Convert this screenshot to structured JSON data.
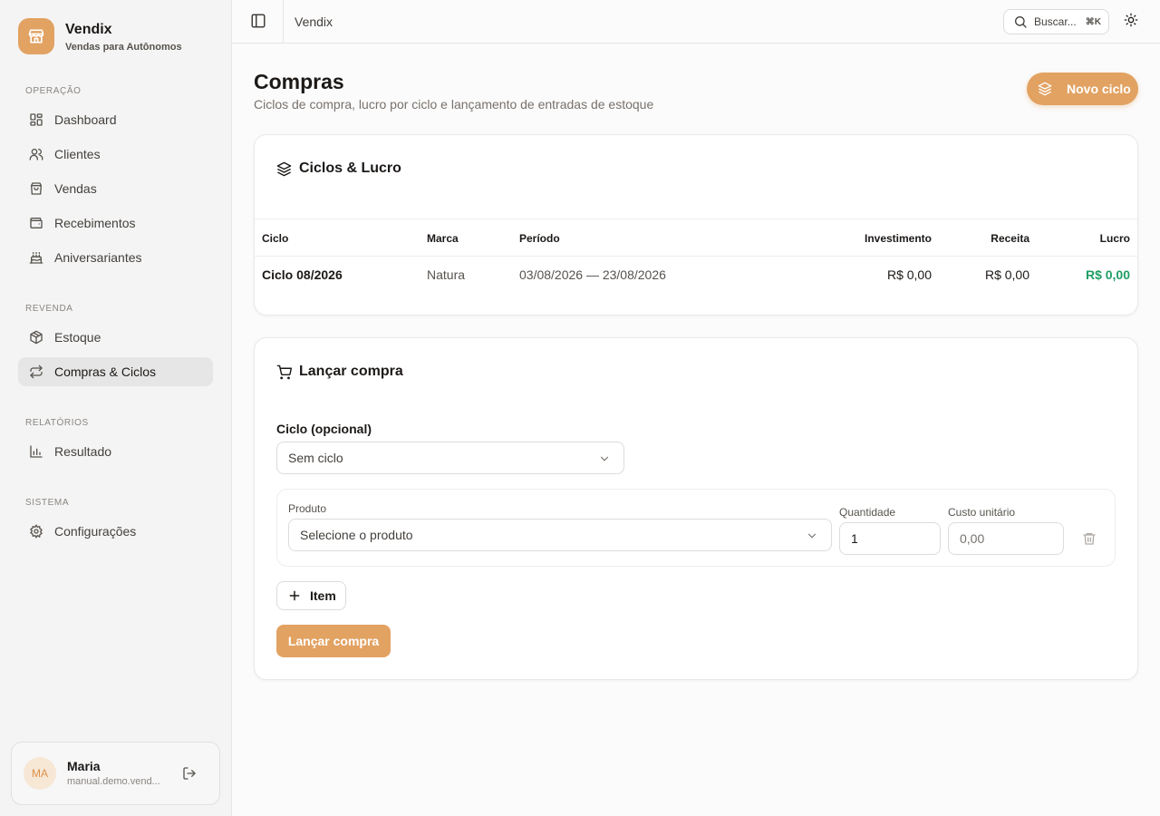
{
  "colors": {
    "accent": "#e2a262",
    "profit": "#1f9d64"
  },
  "brand": {
    "name": "Vendix",
    "subtitle": "Vendas para Autônomos",
    "logo_icon": "store-icon"
  },
  "sidebar": {
    "sections": [
      {
        "label": "Operação"
      },
      {
        "label": "Revenda"
      },
      {
        "label": "Relatórios"
      },
      {
        "label": "Sistema"
      }
    ],
    "items": [
      {
        "label": "Dashboard",
        "icon": "dashboard-icon"
      },
      {
        "label": "Clientes",
        "icon": "users-icon"
      },
      {
        "label": "Vendas",
        "icon": "shopping-bag-icon"
      },
      {
        "label": "Recebimentos",
        "icon": "wallet-icon"
      },
      {
        "label": "Aniversariantes",
        "icon": "cake-icon"
      },
      {
        "label": "Estoque",
        "icon": "package-icon"
      },
      {
        "label": "Compras & Ciclos",
        "icon": "repeat-icon",
        "active": true
      },
      {
        "label": "Resultado",
        "icon": "bar-chart-icon"
      },
      {
        "label": "Configurações",
        "icon": "gear-icon"
      }
    ]
  },
  "user": {
    "initials": "MA",
    "name": "Maria",
    "email": "manual.demo.vend..."
  },
  "header": {
    "title": "Vendix",
    "search_label": "Buscar...",
    "search_shortcut": "⌘K"
  },
  "page": {
    "title": "Compras",
    "subtitle": "Ciclos de compra, lucro por ciclo e lançamento de entradas de estoque",
    "new_cycle_button": "Novo ciclo"
  },
  "cycles": {
    "title": "Ciclos & Lucro",
    "columns": [
      "Ciclo",
      "Marca",
      "Período",
      "Investimento",
      "Receita",
      "Lucro"
    ],
    "rows": [
      {
        "ciclo": "Ciclo 08/2026",
        "marca": "Natura",
        "periodo": "03/08/2026 — 23/08/2026",
        "investimento": "R$ 0,00",
        "receita": "R$ 0,00",
        "lucro": "R$ 0,00"
      }
    ]
  },
  "purchase": {
    "title": "Lançar compra",
    "cycle_label": "Ciclo (opcional)",
    "cycle_value": "Sem ciclo",
    "product_label": "Produto",
    "product_placeholder": "Selecione o produto",
    "quantity_label": "Quantidade",
    "quantity_value": "1",
    "unit_cost_label": "Custo unitário",
    "unit_cost_placeholder": "0,00",
    "add_item_button": "Item",
    "submit_button": "Lançar compra"
  }
}
